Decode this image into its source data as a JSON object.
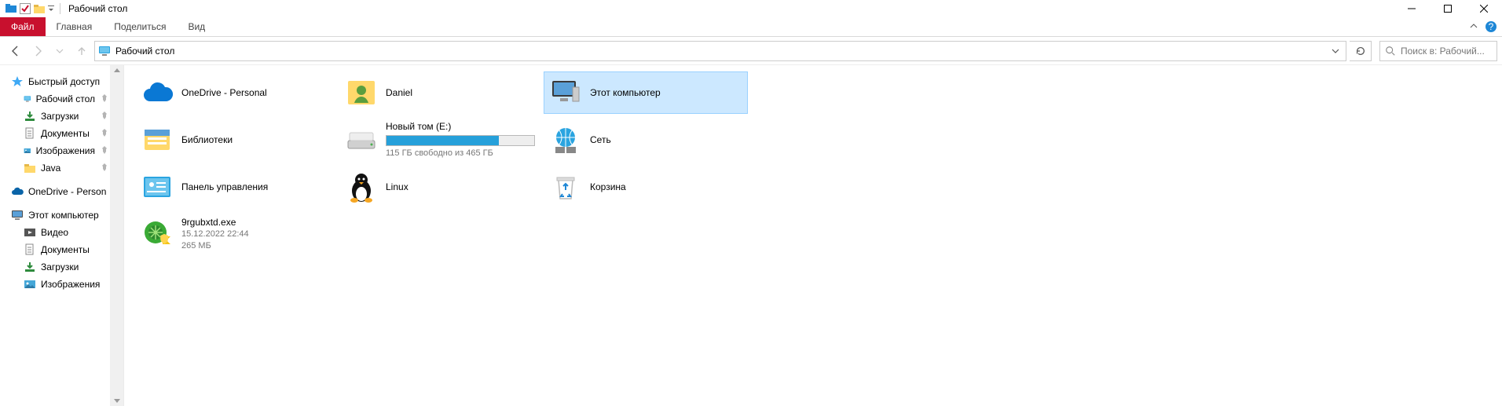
{
  "window": {
    "title": "Рабочий стол"
  },
  "ribbon": {
    "file": "Файл",
    "tabs": [
      "Главная",
      "Поделиться",
      "Вид"
    ]
  },
  "address": {
    "path": "Рабочий стол"
  },
  "search": {
    "placeholder": "Поиск в: Рабочий..."
  },
  "sidebar": {
    "quick_access": {
      "label": "Быстрый доступ",
      "items": [
        {
          "label": "Рабочий стол",
          "icon": "desktop",
          "pinned": true
        },
        {
          "label": "Загрузки",
          "icon": "downloads",
          "pinned": true
        },
        {
          "label": "Документы",
          "icon": "documents",
          "pinned": true
        },
        {
          "label": "Изображения",
          "icon": "pictures",
          "pinned": true
        },
        {
          "label": "Java",
          "icon": "folder",
          "pinned": true
        }
      ]
    },
    "onedrive": {
      "label": "OneDrive - Person"
    },
    "thispc": {
      "label": "Этот компьютер",
      "items": [
        {
          "label": "Видео",
          "icon": "videos"
        },
        {
          "label": "Документы",
          "icon": "documents"
        },
        {
          "label": "Загрузки",
          "icon": "downloads"
        },
        {
          "label": "Изображения",
          "icon": "pictures"
        }
      ]
    }
  },
  "content": {
    "items": [
      {
        "id": "onedrive",
        "label": "OneDrive - Personal",
        "icon": "cloud"
      },
      {
        "id": "user",
        "label": "Daniel",
        "icon": "user"
      },
      {
        "id": "thispc",
        "label": "Этот компьютер",
        "icon": "pc",
        "selected": true
      },
      {
        "id": "libraries",
        "label": "Библиотеки",
        "icon": "libraries"
      },
      {
        "id": "drive",
        "label": "Новый том (E:)",
        "icon": "hdd",
        "drive": {
          "free_text": "115 ГБ свободно из 465 ГБ",
          "fill_pct": 76
        }
      },
      {
        "id": "network",
        "label": "Сеть",
        "icon": "network"
      },
      {
        "id": "cpl",
        "label": "Панель управления",
        "icon": "cpanel"
      },
      {
        "id": "linux",
        "label": "Linux",
        "icon": "penguin"
      },
      {
        "id": "recycle",
        "label": "Корзина",
        "icon": "recycle"
      },
      {
        "id": "exe",
        "label": "9rgubxtd.exe",
        "icon": "shield",
        "sub1": "15.12.2022 22:44",
        "sub2": "265 МБ"
      }
    ]
  }
}
